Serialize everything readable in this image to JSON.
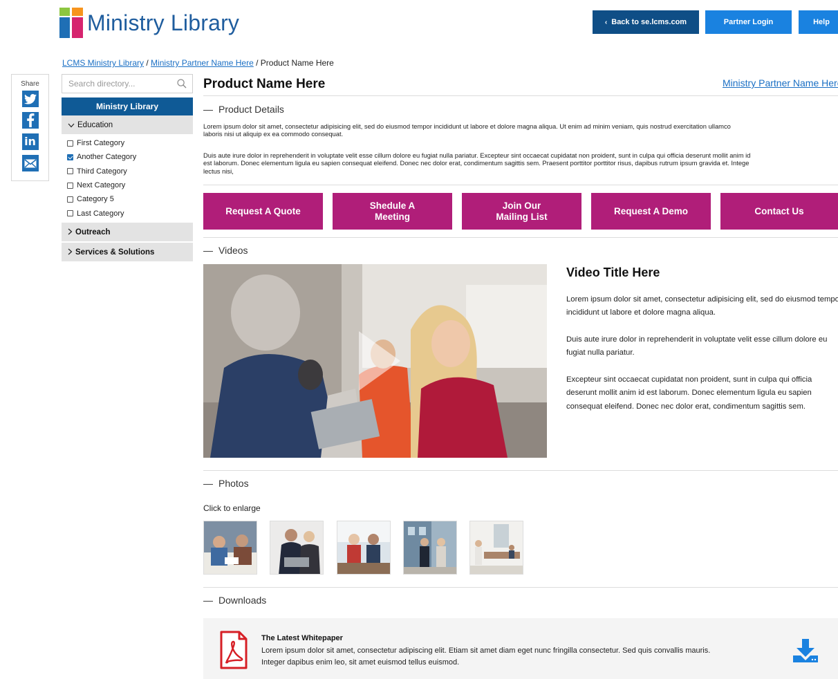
{
  "brand": {
    "logo_text": "Ministry Library"
  },
  "header": {
    "back_label": "Back to se.lcms.com",
    "partner_login_label": "Partner Login",
    "help_label": "Help"
  },
  "breadcrumb": {
    "items": [
      "LCMS Ministry Library",
      "Ministry Partner Name Here"
    ],
    "separator": " / ",
    "current": "Product Name Here"
  },
  "share": {
    "label": "Share",
    "icons": [
      "twitter-icon",
      "facebook-icon",
      "linkedin-icon",
      "email-icon"
    ]
  },
  "sidebar": {
    "search_placeholder": "Search directory...",
    "title": "Ministry Library",
    "groups": [
      {
        "label": "Education",
        "expanded": true,
        "categories": [
          {
            "label": "First Category",
            "checked": false
          },
          {
            "label": "Another Category",
            "checked": true
          },
          {
            "label": "Third Category",
            "checked": false
          },
          {
            "label": "Next Category",
            "checked": false
          },
          {
            "label": "Category 5",
            "checked": false
          },
          {
            "label": "Last Category",
            "checked": false
          }
        ]
      },
      {
        "label": "Outreach",
        "expanded": false
      },
      {
        "label": "Services & Solutions",
        "expanded": false
      }
    ]
  },
  "product": {
    "title": "Product Name Here",
    "partner_link": "Ministry Partner Name Here",
    "details_heading": "Product Details",
    "details_p1": [
      "Lorem ipsum dolor sit amet, consectetur adipisicing elit, sed do eiusmod tempor incididunt ut labore et dolore magna aliqua. Ut enim ad minim veniam, quis nostrud exercitation ullamco",
      "laboris nisi ut aliquip ex ea commodo consequat."
    ],
    "details_p2": [
      "Duis aute irure dolor in reprehenderit in voluptate velit esse cillum dolore eu fugiat nulla pariatur. Excepteur sint occaecat cupidatat non proident, sunt in culpa qui officia deserunt mollit anim id",
      "est laborum. Donec elementum ligula eu sapien consequat eleifend. Donec nec dolor erat, condimentum sagittis sem. Praesent porttitor porttitor risus, dapibus rutrum ipsum gravida et. Intege",
      "lectus nisi,"
    ]
  },
  "cta_buttons": [
    "Request A Quote",
    "Shedule A\nMeeting",
    "Join Our\nMailing List",
    "Request A Demo",
    "Contact Us"
  ],
  "videos": {
    "heading": "Videos",
    "title": "Video Title Here",
    "paragraphs": [
      "Lorem ipsum dolor sit amet, consectetur adipisicing elit, sed do eiusmod tempor incididunt ut labore et dolore magna aliqua.",
      "Duis aute irure dolor in reprehenderit in voluptate velit esse cillum dolore eu fugiat nulla pariatur.",
      "Excepteur sint occaecat cupidatat non proident, sunt in culpa qui officia deserunt mollit anim id est laborum. Donec elementum ligula eu sapien consequat eleifend. Donec nec dolor erat, condimentum sagittis sem."
    ]
  },
  "photos": {
    "heading": "Photos",
    "hint": "Click to enlarge",
    "count": 5
  },
  "downloads": {
    "heading": "Downloads",
    "items": [
      {
        "title": "The Latest Whitepaper",
        "description_lines": [
          "Lorem ipsum dolor sit amet, consectetur adipiscing elit. Etiam sit amet diam eget nunc fringilla consectetur. Sed quis convallis mauris.",
          "Integer dapibus enim leo, sit amet euismod tellus euismod."
        ]
      }
    ]
  },
  "colors": {
    "brand_blue": "#1f5d9e",
    "nav_dark_blue": "#0f4e86",
    "button_blue": "#1a82e0",
    "cta_magenta": "#b01e79",
    "link_blue": "#1a6fc4",
    "pdf_red": "#d61f26"
  }
}
